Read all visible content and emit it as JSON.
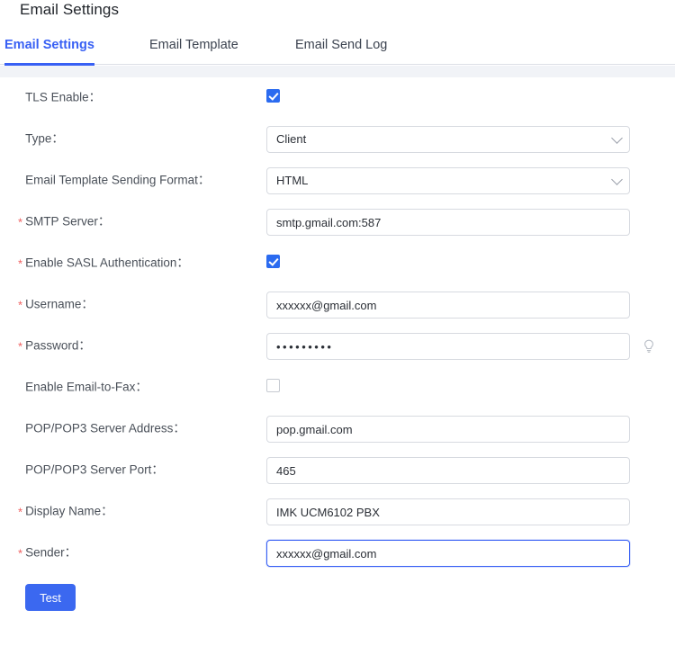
{
  "header": {
    "title": "Email Settings"
  },
  "tabs": [
    {
      "label": "Email Settings",
      "active": true
    },
    {
      "label": "Email Template",
      "active": false
    },
    {
      "label": "Email Send Log",
      "active": false
    }
  ],
  "form": {
    "rows": [
      {
        "label": "TLS Enable：",
        "required": false,
        "type": "checkbox",
        "checked": true
      },
      {
        "label": "Type：",
        "required": false,
        "type": "select",
        "value": "Client"
      },
      {
        "label": "Email Template Sending Format：",
        "required": false,
        "type": "select",
        "value": "HTML"
      },
      {
        "label": "SMTP Server：",
        "required": true,
        "type": "text",
        "value": "smtp.gmail.com:587"
      },
      {
        "label": "Enable SASL Authentication：",
        "required": true,
        "type": "checkbox",
        "checked": true
      },
      {
        "label": "Username：",
        "required": true,
        "type": "text",
        "value": "xxxxxx@gmail.com"
      },
      {
        "label": "Password：",
        "required": true,
        "type": "password",
        "value": "•••••••••",
        "hint_icon": "lightbulb-icon"
      },
      {
        "label": "Enable Email-to-Fax：",
        "required": false,
        "type": "checkbox",
        "checked": false
      },
      {
        "label": "POP/POP3 Server Address：",
        "required": false,
        "type": "text",
        "value": "pop.gmail.com"
      },
      {
        "label": "POP/POP3 Server Port：",
        "required": false,
        "type": "text",
        "value": "465"
      },
      {
        "label": "Display Name：",
        "required": true,
        "type": "text",
        "value": "IMK UCM6102 PBX"
      },
      {
        "label": "Sender：",
        "required": true,
        "type": "text",
        "value": "xxxxxx@gmail.com",
        "focused": true
      }
    ],
    "required_marker": "*",
    "test_button": "Test"
  },
  "colors": {
    "accent": "#3860f4",
    "button": "#3b68f0",
    "checkbox_on": "#2b6bf0",
    "required_star": "#f06060",
    "band": "#f1f3f7"
  }
}
